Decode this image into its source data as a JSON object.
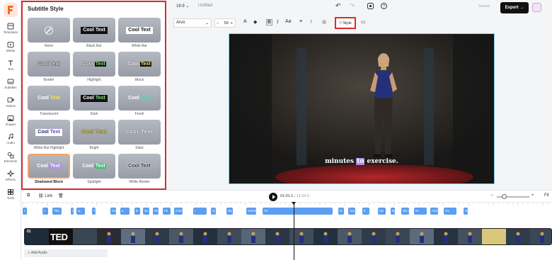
{
  "app": {
    "logo_letter": "F",
    "aspect_ratio": "16:9",
    "project_title": "Untitled",
    "saved_label": "Saved",
    "export_label": "Export"
  },
  "rail": [
    {
      "label": "Templates",
      "icon": "templates-icon"
    },
    {
      "label": "Media",
      "icon": "media-icon"
    },
    {
      "label": "Text",
      "icon": "text-icon"
    },
    {
      "label": "Subtitles",
      "icon": "subtitles-icon"
    },
    {
      "label": "Videos",
      "icon": "videos-icon"
    },
    {
      "label": "Images",
      "icon": "images-icon"
    },
    {
      "label": "Audio",
      "icon": "audio-icon"
    },
    {
      "label": "Elements",
      "icon": "elements-icon"
    },
    {
      "label": "Effects",
      "icon": "effects-icon"
    },
    {
      "label": "Tools",
      "icon": "tools-icon"
    }
  ],
  "panel": {
    "title": "Subtitle Style",
    "sample": {
      "a": "Cool",
      "b": "Text"
    },
    "styles": [
      {
        "name": "None"
      },
      {
        "name": "Black Bar"
      },
      {
        "name": "White Bar"
      },
      {
        "name": "Border"
      },
      {
        "name": "Highlight"
      },
      {
        "name": "Block"
      },
      {
        "name": "Translucent"
      },
      {
        "name": "Dark"
      },
      {
        "name": "Fresh"
      },
      {
        "name": "White Bar Highlight"
      },
      {
        "name": "Bright"
      },
      {
        "name": "Slant"
      },
      {
        "name": "Shadowed Block"
      },
      {
        "name": "Spotlight"
      },
      {
        "name": "White Border"
      }
    ],
    "selected": "Shadowed Block"
  },
  "format": {
    "font": "Arvo",
    "size": "50",
    "minus": "−",
    "plus": "+",
    "style_label": "Style"
  },
  "video": {
    "subtitle_before": "minutes",
    "subtitle_highlight": "to",
    "subtitle_after": "exercise."
  },
  "timeline": {
    "link_label": "Link",
    "current_time": "01:01.1",
    "total_time": "/ 11:34.0",
    "fit_label": "Fit",
    "track_number": "01",
    "add_audio_label": "Add Audio",
    "clip_text": "TED",
    "chips": [
      "I.",
      "I",
      "The",
      "I",
      "w.",
      "T",
      "Ha",
      "a",
      "E",
      "Su",
      "Re",
      "Fil",
      "And I",
      "I",
      "Q",
      "Ba.",
      "minutes to exercise",
      "Yo",
      "D.",
      "Ara",
      "It",
      "Ou",
      "Now",
      "We d",
      "W",
      "And",
      "I'm",
      "One of the women whe"
    ]
  },
  "colors": {
    "accent_red": "#d32f2f",
    "chip_blue": "#5b9ef2",
    "highlight_purple": "#b08ae0"
  }
}
